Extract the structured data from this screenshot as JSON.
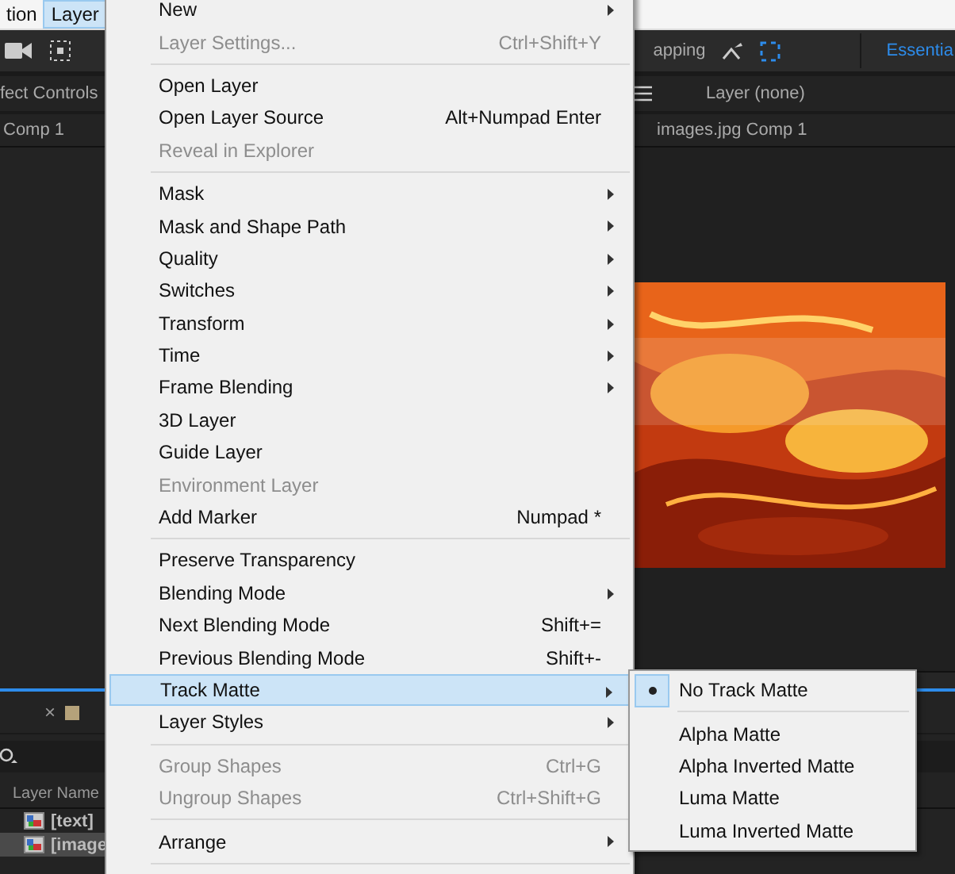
{
  "menubar": [
    {
      "label": "tion",
      "selected": false
    },
    {
      "label": "Layer",
      "selected": true
    }
  ],
  "toolbar": {
    "snapping_label": "apping",
    "workspace": "Essentia"
  },
  "left_panel": {
    "title": "fect Controls",
    "tab": "Comp 1"
  },
  "viewer": {
    "title": "Layer (none)",
    "tab": "images.jpg Comp 1"
  },
  "timeline": {
    "tab_close": "×",
    "column": "Layer Name",
    "rows": [
      {
        "name": "[text]",
        "selected": false
      },
      {
        "name": "[image",
        "selected": true
      }
    ]
  },
  "layer_menu": [
    {
      "kind": "item",
      "label": "New",
      "disabled": false,
      "submenu": true,
      "selected": false
    },
    {
      "kind": "item",
      "label": "Layer Settings...",
      "shortcut": "Ctrl+Shift+Y",
      "disabled": true,
      "submenu": false,
      "selected": false
    },
    {
      "kind": "separator"
    },
    {
      "kind": "item",
      "label": "Open Layer",
      "disabled": false,
      "submenu": false,
      "selected": false
    },
    {
      "kind": "item",
      "label": "Open Layer Source",
      "shortcut": "Alt+Numpad Enter",
      "disabled": false,
      "submenu": false,
      "selected": false
    },
    {
      "kind": "item",
      "label": "Reveal in Explorer",
      "disabled": true,
      "submenu": false,
      "selected": false
    },
    {
      "kind": "separator"
    },
    {
      "kind": "item",
      "label": "Mask",
      "disabled": false,
      "submenu": true,
      "selected": false
    },
    {
      "kind": "item",
      "label": "Mask and Shape Path",
      "disabled": false,
      "submenu": true,
      "selected": false
    },
    {
      "kind": "item",
      "label": "Quality",
      "disabled": false,
      "submenu": true,
      "selected": false
    },
    {
      "kind": "item",
      "label": "Switches",
      "disabled": false,
      "submenu": true,
      "selected": false
    },
    {
      "kind": "item",
      "label": "Transform",
      "disabled": false,
      "submenu": true,
      "selected": false
    },
    {
      "kind": "item",
      "label": "Time",
      "disabled": false,
      "submenu": true,
      "selected": false
    },
    {
      "kind": "item",
      "label": "Frame Blending",
      "disabled": false,
      "submenu": true,
      "selected": false
    },
    {
      "kind": "item",
      "label": "3D Layer",
      "disabled": false,
      "submenu": false,
      "selected": false
    },
    {
      "kind": "item",
      "label": "Guide Layer",
      "disabled": false,
      "submenu": false,
      "selected": false
    },
    {
      "kind": "item",
      "label": "Environment Layer",
      "disabled": true,
      "submenu": false,
      "selected": false
    },
    {
      "kind": "item",
      "label": "Add Marker",
      "shortcut": "Numpad *",
      "disabled": false,
      "submenu": false,
      "selected": false
    },
    {
      "kind": "separator"
    },
    {
      "kind": "item",
      "label": "Preserve Transparency",
      "disabled": false,
      "submenu": false,
      "selected": false
    },
    {
      "kind": "item",
      "label": "Blending Mode",
      "disabled": false,
      "submenu": true,
      "selected": false
    },
    {
      "kind": "item",
      "label": "Next Blending Mode",
      "shortcut": "Shift+=",
      "disabled": false,
      "submenu": false,
      "selected": false
    },
    {
      "kind": "item",
      "label": "Previous Blending Mode",
      "shortcut": "Shift+-",
      "disabled": false,
      "submenu": false,
      "selected": false
    },
    {
      "kind": "item",
      "label": "Track Matte",
      "disabled": false,
      "submenu": true,
      "selected": true
    },
    {
      "kind": "item",
      "label": "Layer Styles",
      "disabled": false,
      "submenu": true,
      "selected": false
    },
    {
      "kind": "separator"
    },
    {
      "kind": "item",
      "label": "Group Shapes",
      "shortcut": "Ctrl+G",
      "disabled": true,
      "submenu": false,
      "selected": false
    },
    {
      "kind": "item",
      "label": "Ungroup Shapes",
      "shortcut": "Ctrl+Shift+G",
      "disabled": true,
      "submenu": false,
      "selected": false
    },
    {
      "kind": "separator"
    },
    {
      "kind": "item",
      "label": "Arrange",
      "disabled": false,
      "submenu": true,
      "selected": false
    },
    {
      "kind": "separator"
    }
  ],
  "track_matte_menu": [
    {
      "kind": "item",
      "label": "No Track Matte",
      "selected": true
    },
    {
      "kind": "separator"
    },
    {
      "kind": "item",
      "label": "Alpha Matte",
      "selected": false
    },
    {
      "kind": "item",
      "label": "Alpha Inverted Matte",
      "selected": false
    },
    {
      "kind": "item",
      "label": "Luma Matte",
      "selected": false
    },
    {
      "kind": "item",
      "label": "Luma Inverted Matte",
      "selected": false
    }
  ]
}
